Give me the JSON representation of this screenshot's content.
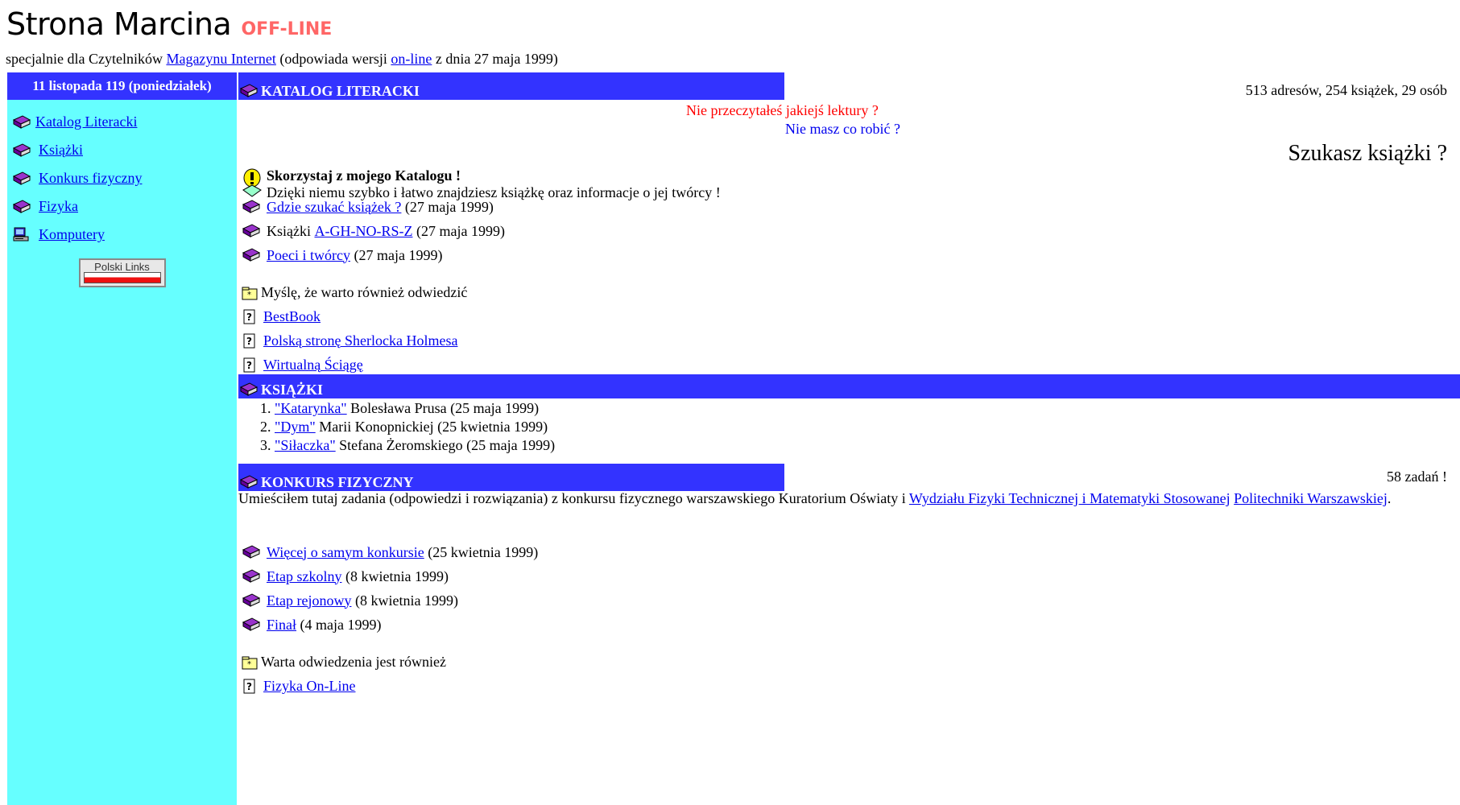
{
  "header": {
    "title": "Strona Marcina",
    "badge": "OFF-LINE",
    "subtitle_prefix": "specjalnie dla Czytelników",
    "magazine_link": "Magazynu Internet",
    "subtitle_mid": "(odpowiada wersji",
    "online_link": "on-line",
    "subtitle_suffix": "z dnia 27 maja 1999)"
  },
  "sidebar": {
    "date": "11 listopada 119 (poniedziałek)",
    "items": [
      {
        "label": "Katalog Literacki",
        "icon": "book-icon"
      },
      {
        "label": "Książki",
        "icon": "book-icon"
      },
      {
        "label": "Konkurs fizyczny",
        "icon": "book-icon"
      },
      {
        "label": "Fizyka",
        "icon": "book-icon"
      },
      {
        "label": "Komputery",
        "icon": "computer-icon"
      }
    ],
    "banner": "Polski Links"
  },
  "katalog": {
    "heading": "KATALOG LITERACKI",
    "stats": "513 adresów, 254 książek, 29 osób",
    "question_red": "Nie przeczytałeś jakiejś lektury ?",
    "question_blue": "Nie masz co robić ?",
    "question_big": "Szukasz książki ?",
    "tip_bold": "Skorzystaj z mojego Katalogu !",
    "tip_text": "Dzięki niemu szybko i łatwo znajdziesz książkę oraz informacje o jej twórcy !",
    "links": [
      {
        "prefix": "",
        "link": "Gdzie szukać książek ?",
        "date": "(27 maja 1999)"
      },
      {
        "prefix": "Książki ",
        "link": "A-GH-NO-RS-Z",
        "date": " (27 maja 1999)"
      },
      {
        "prefix": "",
        "link": "Poeci i twórcy",
        "date": "(27 maja 1999)"
      }
    ],
    "also_visit": "Myślę, że warto również odwiedzić",
    "external": [
      "BestBook",
      "Polską stronę Sherlocka Holmesa",
      "Wirtualną Ściągę"
    ]
  },
  "ksiazki": {
    "heading": "KSIĄŻKI",
    "items": [
      {
        "link": "\"Katarynka\"",
        "rest": "Bolesława Prusa (25 maja 1999)"
      },
      {
        "link": "\"Dym\"",
        "rest": "Marii Konopnickiej (25 kwietnia 1999)"
      },
      {
        "link": "\"Siłaczka\"",
        "rest": "Stefana Żeromskiego (25 maja 1999)"
      }
    ]
  },
  "konkurs": {
    "heading": "KONKURS FIZYCZNY",
    "count": "58 zadań !",
    "para_text": "Umieściłem tutaj zadania (odpowiedzi i rozwiązania) z konkursu fizycznego warszawskiego Kuratorium Oświaty i",
    "para_link1": "Wydziału Fizyki Technicznej i Matematyki Stosowanej",
    "para_link2": "Politechniki Warszawskiej",
    "para_end": ".",
    "links": [
      {
        "link": "Więcej o samym konkursie",
        "date": "(25 kwietnia 1999)"
      },
      {
        "link": "Etap szkolny",
        "date": "(8 kwietnia 1999)"
      },
      {
        "link": "Etap rejonowy",
        "date": "(8 kwietnia 1999)"
      },
      {
        "link": "Finał",
        "date": "(4 maja 1999)"
      }
    ],
    "also_visit": "Warta odwiedzenia jest również",
    "external": [
      "Fizyka On-Line"
    ]
  },
  "colors": {
    "bar": "#3333ff",
    "sidebar": "#66ffff",
    "offline": "#ff6666",
    "link": "#0000ee"
  }
}
